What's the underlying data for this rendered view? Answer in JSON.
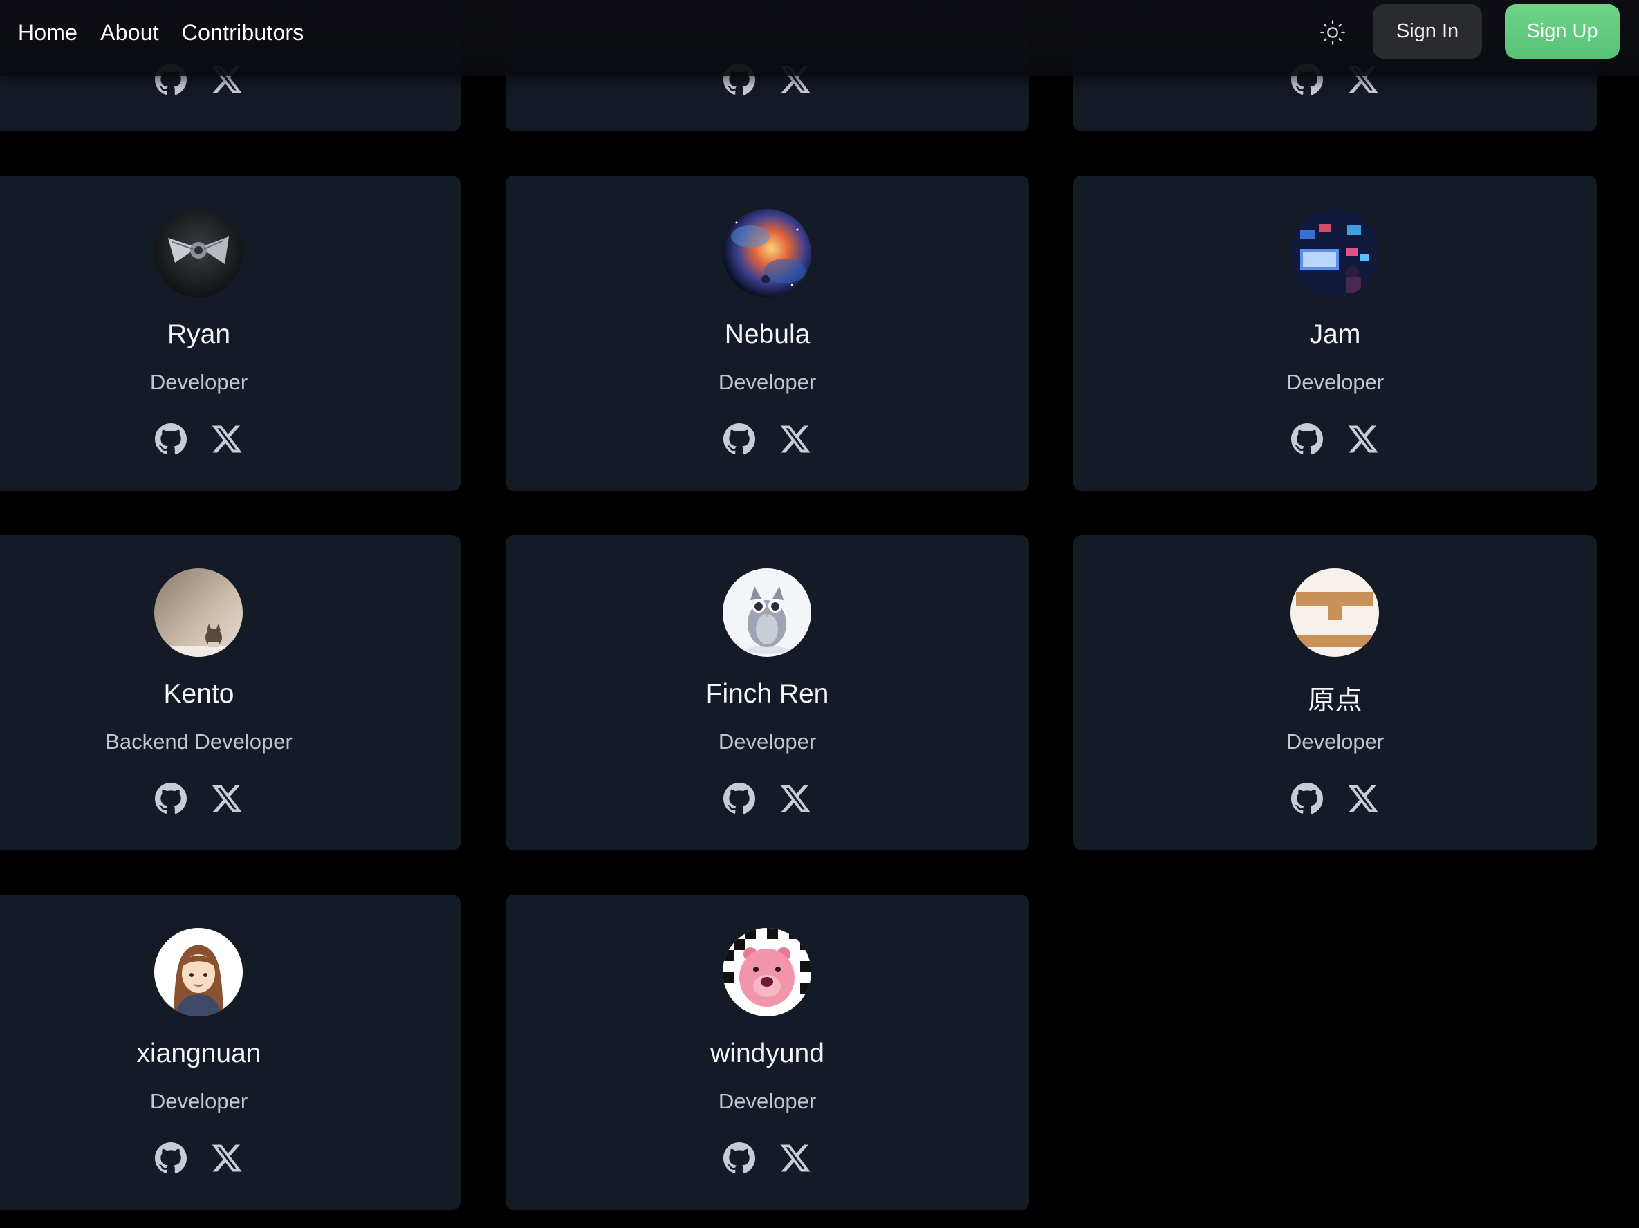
{
  "header": {
    "nav": [
      {
        "label": "Home"
      },
      {
        "label": "About"
      },
      {
        "label": "Contributors"
      }
    ],
    "theme_icon": "sun-icon",
    "sign_in_label": "Sign In",
    "sign_up_label": "Sign Up",
    "accent_color": "#5fca7f"
  },
  "contributors": [
    {
      "name": "",
      "role": "",
      "avatar": "partially-hidden"
    },
    {
      "name": "",
      "role": "",
      "avatar": "partially-hidden"
    },
    {
      "name": "",
      "role": "",
      "avatar": "partially-hidden"
    },
    {
      "name": "Ryan",
      "role": "Developer",
      "avatar": "spaceship"
    },
    {
      "name": "Nebula",
      "role": "Developer",
      "avatar": "nebula"
    },
    {
      "name": "Jam",
      "role": "Developer",
      "avatar": "gaming-room"
    },
    {
      "name": "Kento",
      "role": "Backend Developer",
      "avatar": "cat-on-desk"
    },
    {
      "name": "Finch Ren",
      "role": "Developer",
      "avatar": "owl"
    },
    {
      "name": "原点",
      "role": "Developer",
      "avatar": "logo-t"
    },
    {
      "name": "xiangnuan",
      "role": "Developer",
      "avatar": "girl-illustration"
    },
    {
      "name": "windyund",
      "role": "Developer",
      "avatar": "pink-beaver"
    }
  ],
  "social_icons": [
    "github-icon",
    "x-icon"
  ],
  "colors": {
    "background": "#000000",
    "card": "#151a27",
    "text_primary": "#f4f5f7",
    "text_secondary": "#c3c6cd"
  }
}
